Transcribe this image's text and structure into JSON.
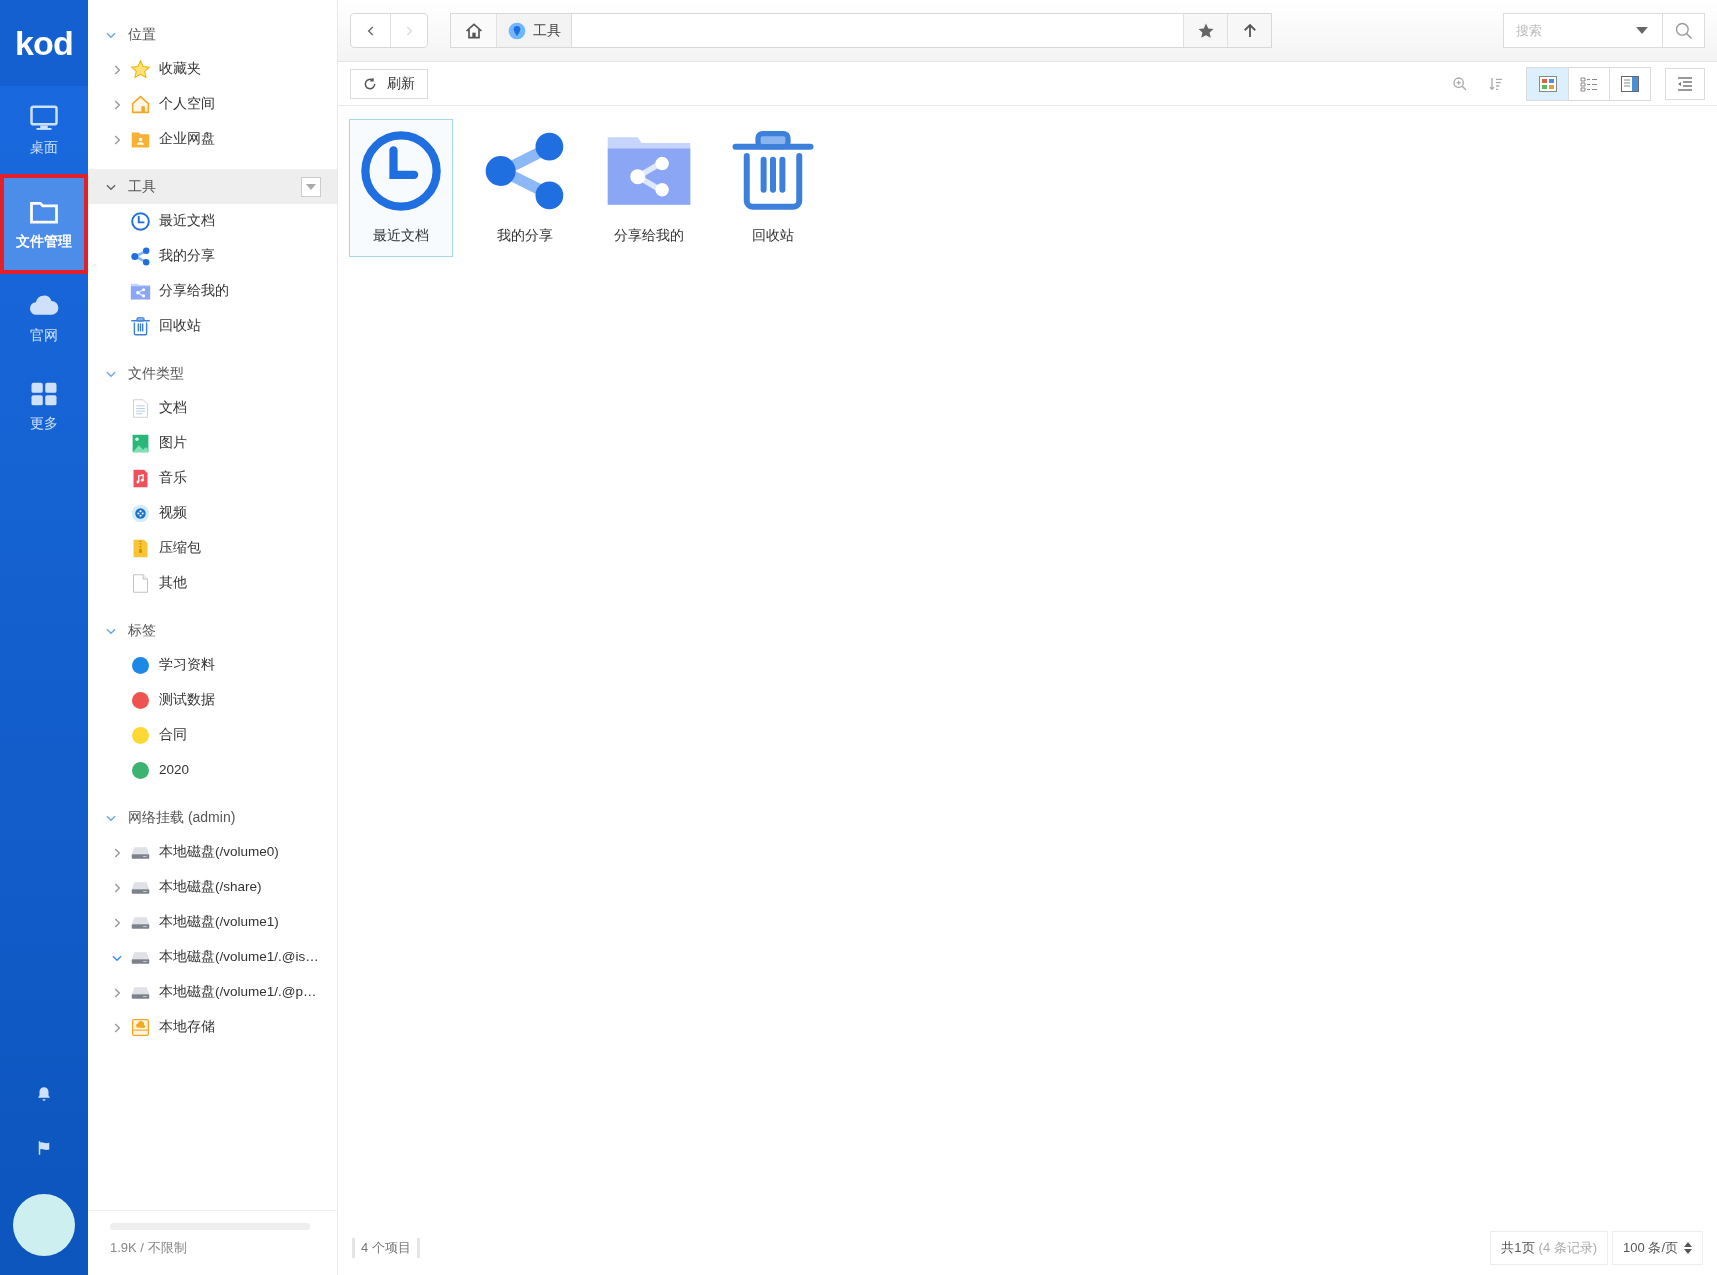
{
  "rail": {
    "logo": "kod",
    "items": [
      {
        "label": "桌面",
        "kind": "monitor",
        "selected": false
      },
      {
        "label": "文件管理",
        "kind": "folder",
        "selected": true
      },
      {
        "label": "官网",
        "kind": "cloud",
        "selected": false
      },
      {
        "label": "更多",
        "kind": "grid",
        "selected": false
      }
    ]
  },
  "tree": [
    {
      "title": "位置",
      "expanded": true,
      "selected": false,
      "menu": false,
      "items": [
        {
          "label": "收藏夹",
          "kind": "star",
          "has_children": true,
          "expanded": false
        },
        {
          "label": "个人空间",
          "kind": "home",
          "has_children": true,
          "expanded": false
        },
        {
          "label": "企业网盘",
          "kind": "folder-user",
          "has_children": true,
          "expanded": false
        }
      ]
    },
    {
      "title": "工具",
      "expanded": true,
      "selected": true,
      "menu": true,
      "items": [
        {
          "label": "最近文档",
          "kind": "clock",
          "has_children": false
        },
        {
          "label": "我的分享",
          "kind": "share",
          "has_children": false
        },
        {
          "label": "分享给我的",
          "kind": "shared-folder",
          "has_children": false
        },
        {
          "label": "回收站",
          "kind": "trash",
          "has_children": false
        }
      ]
    },
    {
      "title": "文件类型",
      "expanded": true,
      "selected": false,
      "menu": false,
      "items": [
        {
          "label": "文档",
          "kind": "doc",
          "has_children": false
        },
        {
          "label": "图片",
          "kind": "image",
          "has_children": false
        },
        {
          "label": "音乐",
          "kind": "music",
          "has_children": false
        },
        {
          "label": "视频",
          "kind": "video",
          "has_children": false
        },
        {
          "label": "压缩包",
          "kind": "zip",
          "has_children": false
        },
        {
          "label": "其他",
          "kind": "file",
          "has_children": false
        }
      ]
    },
    {
      "title": "标签",
      "expanded": true,
      "selected": false,
      "menu": false,
      "items": [
        {
          "label": "学习资料",
          "kind": "dot",
          "has_children": false,
          "color": "#1e88e5"
        },
        {
          "label": "测试数据",
          "kind": "dot",
          "has_children": false,
          "color": "#ef5350"
        },
        {
          "label": "合同",
          "kind": "dot",
          "has_children": false,
          "color": "#fdd835"
        },
        {
          "label": "2020",
          "kind": "dot",
          "has_children": false,
          "color": "#3cb371"
        }
      ]
    },
    {
      "title": "网络挂载 (admin)",
      "expanded": true,
      "selected": false,
      "menu": false,
      "items": [
        {
          "label": "本地磁盘(/volume0)",
          "kind": "drive",
          "has_children": true,
          "expanded": false
        },
        {
          "label": "本地磁盘(/share)",
          "kind": "drive",
          "has_children": true,
          "expanded": false
        },
        {
          "label": "本地磁盘(/volume1)",
          "kind": "drive",
          "has_children": true,
          "expanded": false
        },
        {
          "label": "本地磁盘(/volume1/.@is…",
          "kind": "drive",
          "has_children": true,
          "expanded": true
        },
        {
          "label": "本地磁盘(/volume1/.@p…",
          "kind": "drive",
          "has_children": true,
          "expanded": false
        },
        {
          "label": "本地存储",
          "kind": "storage",
          "has_children": true,
          "expanded": false
        }
      ]
    }
  ],
  "storage": {
    "text": "1.9K / 不限制"
  },
  "toolbar": {
    "back_disabled": false,
    "forward_disabled": true,
    "breadcrumb": "工具",
    "search": {
      "placeholder": "搜索"
    },
    "refresh": "刷新",
    "views": [
      {
        "kind": "thumbs",
        "selected": true
      },
      {
        "kind": "list",
        "selected": false
      },
      {
        "kind": "split",
        "selected": false
      }
    ]
  },
  "files": [
    {
      "label": "最近文档",
      "kind": "clock",
      "selected": true
    },
    {
      "label": "我的分享",
      "kind": "share",
      "selected": false
    },
    {
      "label": "分享给我的",
      "kind": "shared-folder",
      "selected": false
    },
    {
      "label": "回收站",
      "kind": "trash",
      "selected": false
    }
  ],
  "status_bar": {
    "count": "4 个项目",
    "pages": "共1页",
    "records": "(4 条记录)",
    "per_page": "100 条/页"
  }
}
